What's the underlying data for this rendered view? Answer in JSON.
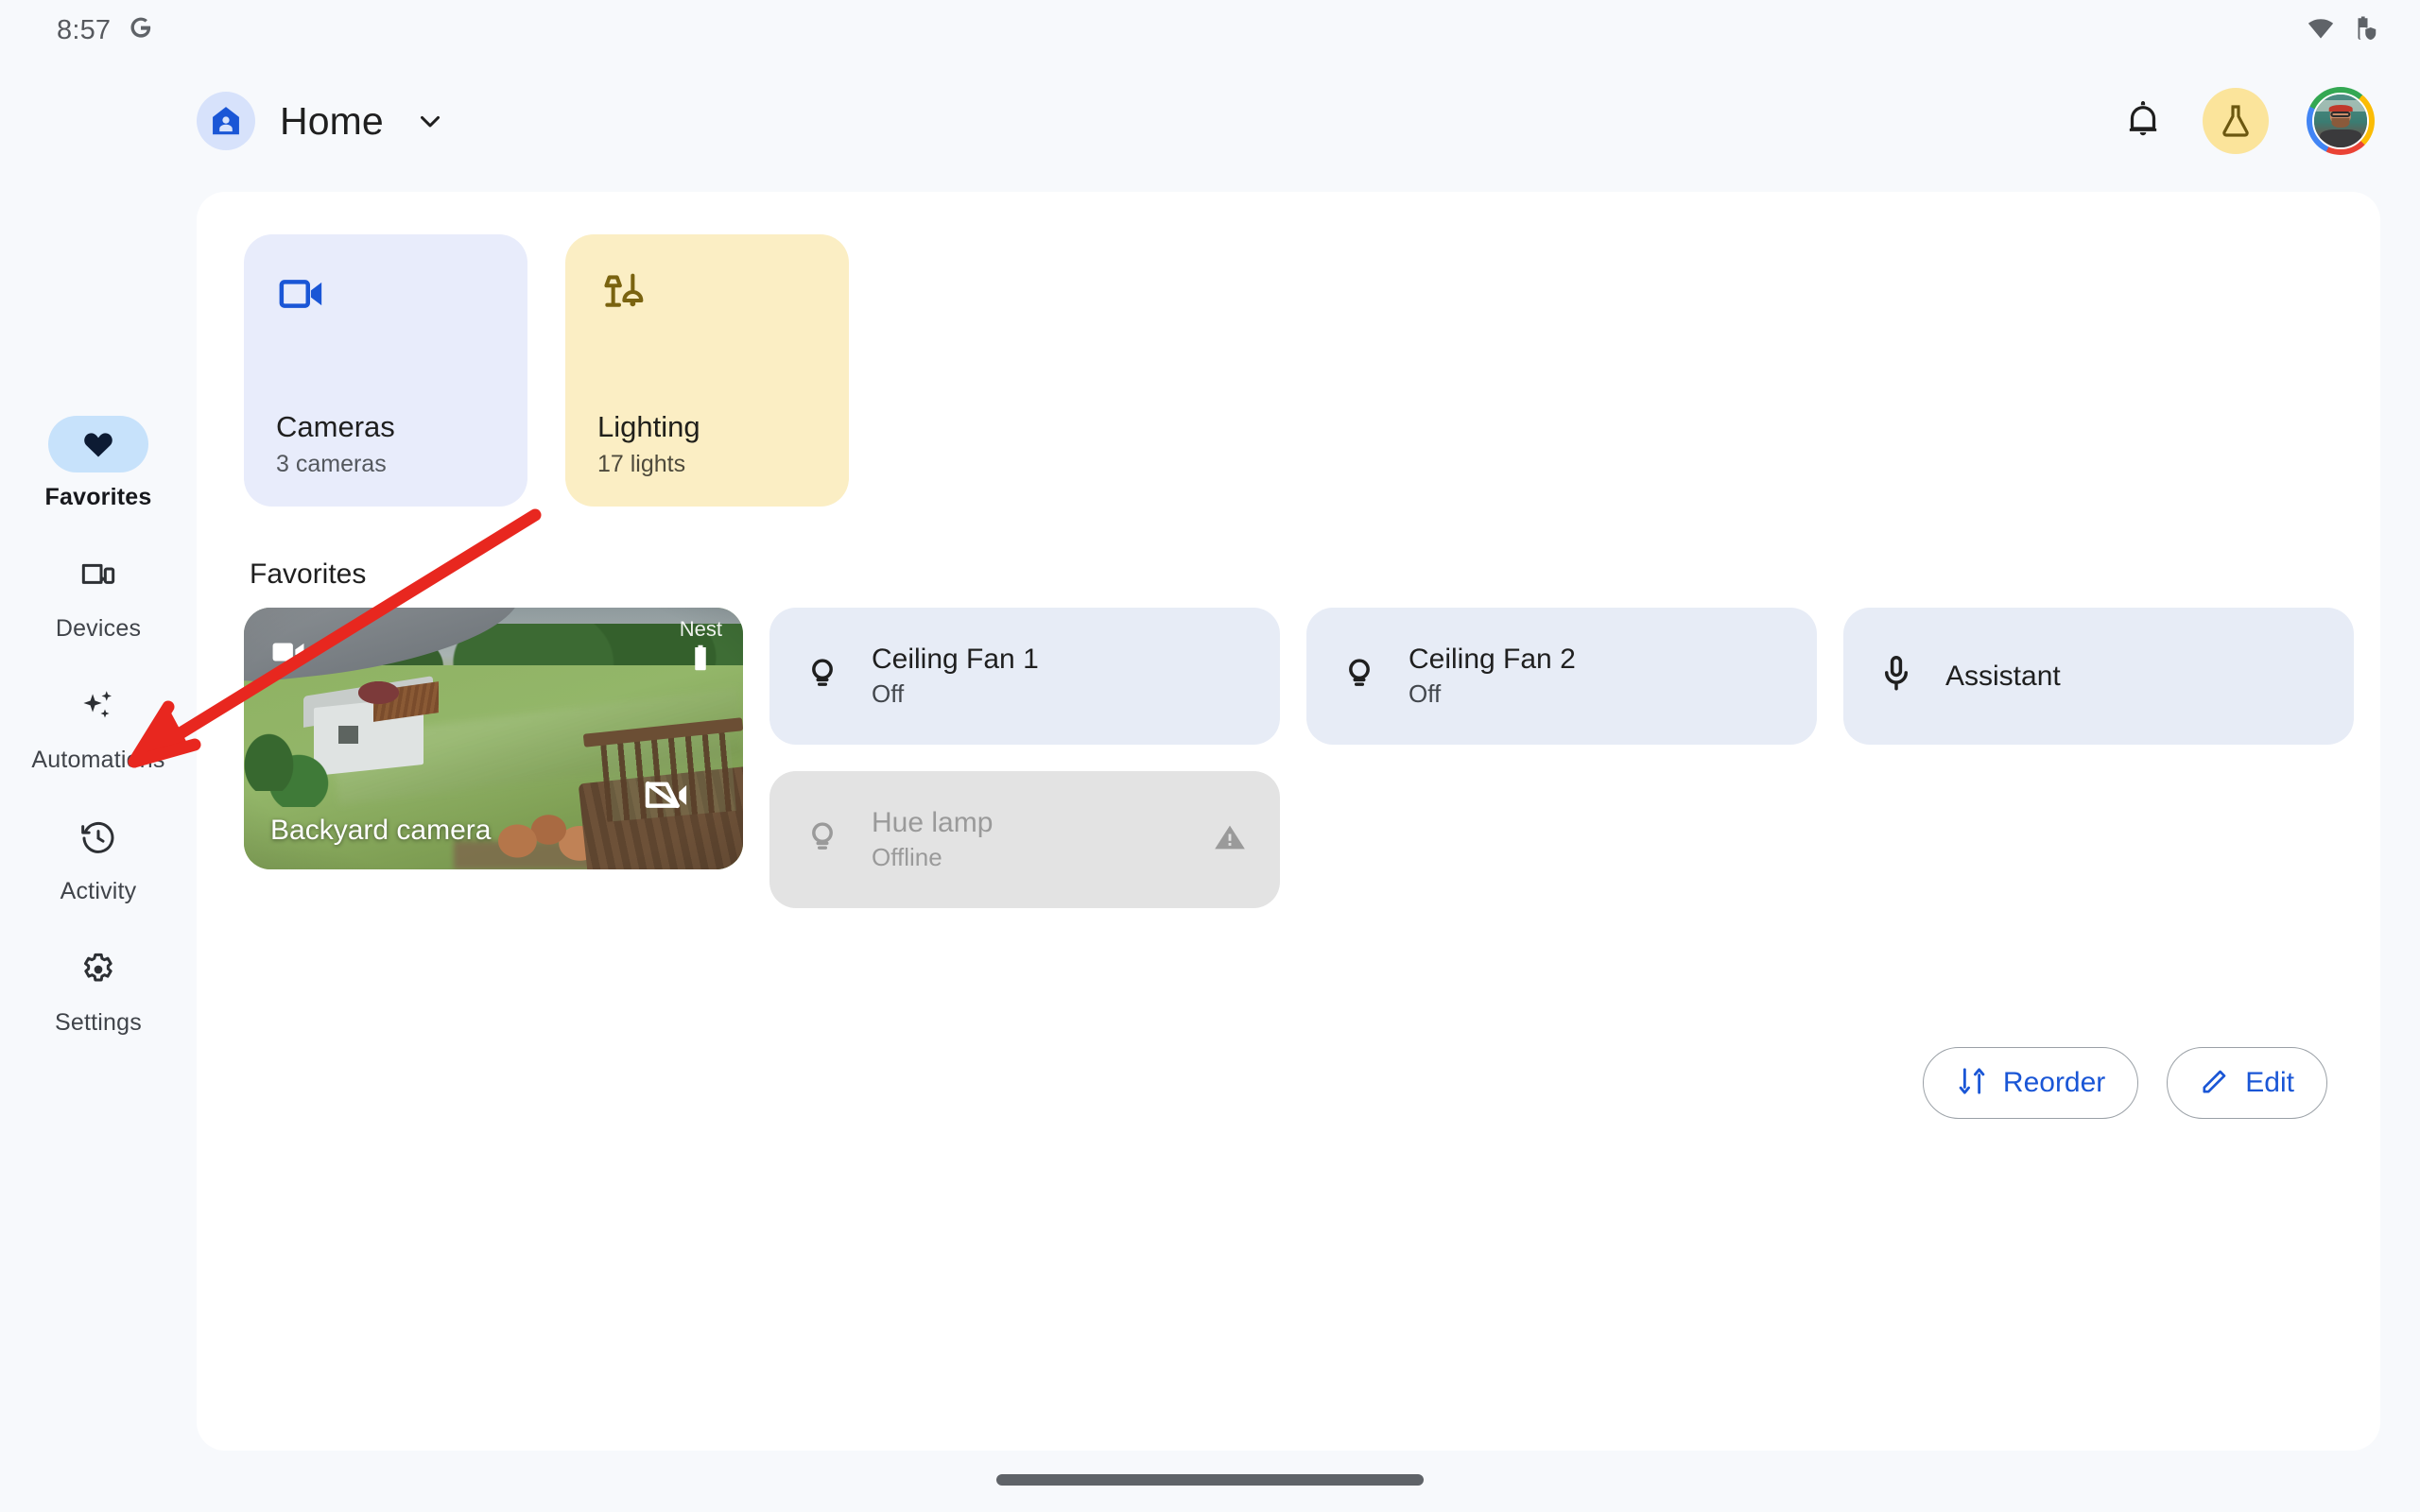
{
  "status_bar": {
    "time": "8:57",
    "left_icons": [
      "google-g-icon"
    ],
    "right_icons": [
      "wifi-icon",
      "battery-shield-icon"
    ]
  },
  "app_bar": {
    "home_icon": "home-person-icon",
    "title": "Home",
    "dropdown_icon": "chevron-down-icon",
    "notifications_icon": "bell-icon",
    "experiments_icon": "flask-icon",
    "experiments_bg": "#fbe49b",
    "avatar": "user-avatar",
    "avatar_ring_colors": [
      "#ea4335",
      "#fbbc04",
      "#34a853",
      "#4285f4"
    ]
  },
  "sidebar": {
    "items": [
      {
        "label": "Favorites",
        "icon": "heart-icon",
        "active": true
      },
      {
        "label": "Devices",
        "icon": "devices-icon",
        "active": false
      },
      {
        "label": "Automations",
        "icon": "sparkles-icon",
        "active": false
      },
      {
        "label": "Activity",
        "icon": "history-clock-icon",
        "active": false
      },
      {
        "label": "Settings",
        "icon": "gear-icon",
        "active": false
      }
    ],
    "active_pill_color": "#c7e2fb"
  },
  "categories": [
    {
      "title": "Cameras",
      "subtitle": "3 cameras",
      "icon": "video-camera-icon",
      "bg": "#e8ecfb",
      "icon_color": "#1a56d6"
    },
    {
      "title": "Lighting",
      "subtitle": "17 lights",
      "icon": "lamp-icon",
      "bg": "#fbeec4",
      "icon_color": "#7a6310"
    }
  ],
  "favorites": {
    "heading": "Favorites",
    "camera_tile": {
      "name": "Backyard camera",
      "brand": "Nest",
      "overlay_icons": [
        "video-camera-icon",
        "battery-icon",
        "camera-off-icon"
      ]
    },
    "devices": [
      {
        "title": "Ceiling Fan 1",
        "subtitle": "Off",
        "icon": "bulb-icon",
        "state": "off",
        "offline": false
      },
      {
        "title": "Hue lamp",
        "subtitle": "Offline",
        "icon": "bulb-icon",
        "state": "offline",
        "offline": true,
        "badge_icon": "warning-icon"
      },
      {
        "title": "Ceiling Fan 2",
        "subtitle": "Off",
        "icon": "bulb-icon",
        "state": "off",
        "offline": false
      },
      {
        "title": "Assistant",
        "subtitle": "",
        "icon": "microphone-icon",
        "state": "",
        "offline": false
      }
    ]
  },
  "actions": [
    {
      "label": "Reorder",
      "icon": "reorder-arrows-icon",
      "color": "#1a56d6"
    },
    {
      "label": "Edit",
      "icon": "pencil-icon",
      "color": "#1a56d6"
    }
  ],
  "annotation": {
    "type": "arrow",
    "color": "#e8271f",
    "points_to": "sidebar-item-automations"
  }
}
